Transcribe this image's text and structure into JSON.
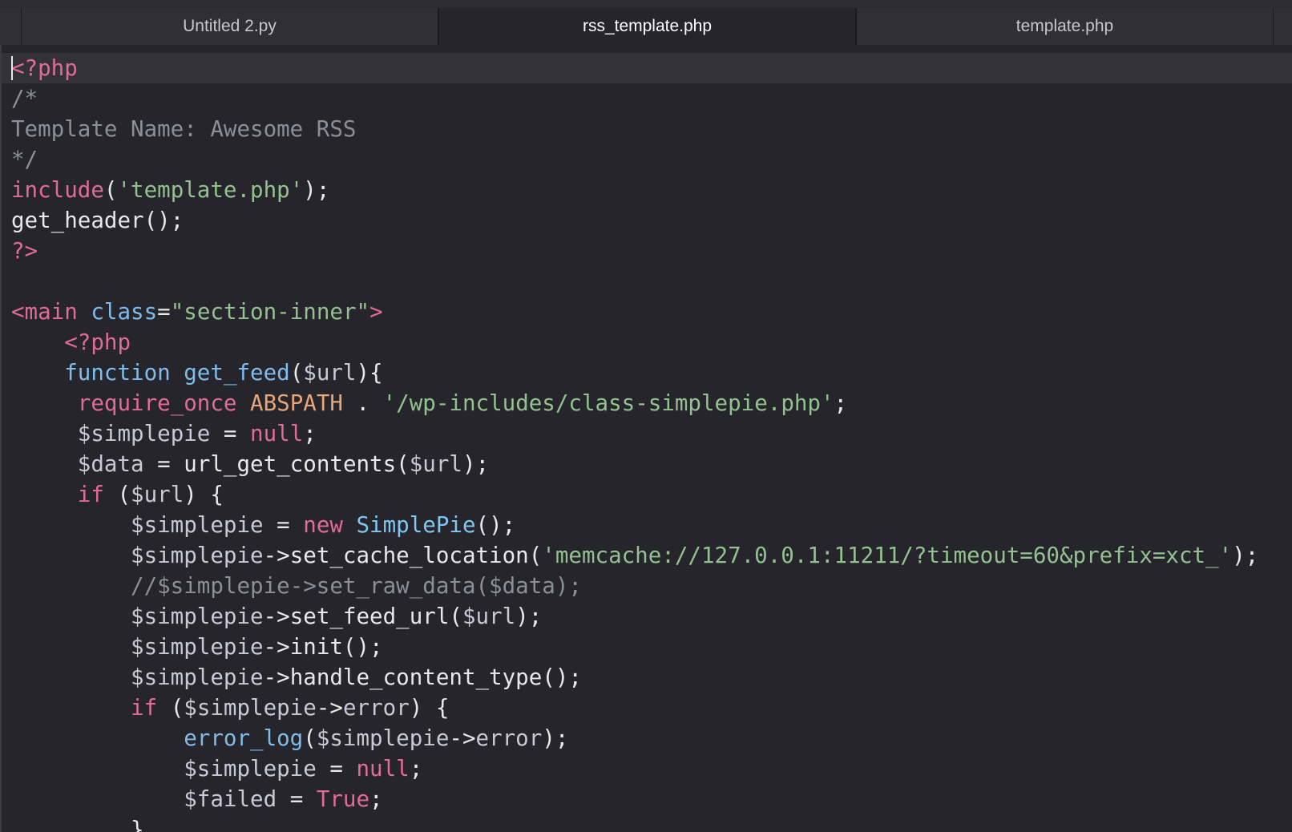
{
  "tabs": [
    {
      "label": "Untitled 2.py",
      "active": false
    },
    {
      "label": "rss_template.php",
      "active": true
    },
    {
      "label": "template.php",
      "active": false
    }
  ],
  "editor": {
    "lines": [
      [
        {
          "t": "<?php",
          "c": "kw"
        }
      ],
      [
        {
          "t": "/*",
          "c": "comment"
        }
      ],
      [
        {
          "t": "Template Name: Awesome RSS",
          "c": "comment"
        }
      ],
      [
        {
          "t": "*/",
          "c": "comment"
        }
      ],
      [
        {
          "t": "include",
          "c": "kw"
        },
        {
          "t": "(",
          "c": "plain"
        },
        {
          "t": "'template.php'",
          "c": "str"
        },
        {
          "t": ");",
          "c": "plain"
        }
      ],
      [
        {
          "t": "get_header();",
          "c": "plain"
        }
      ],
      [
        {
          "t": "?>",
          "c": "kw"
        }
      ],
      [],
      [
        {
          "t": "<main",
          "c": "tag"
        },
        {
          "t": " ",
          "c": "plain"
        },
        {
          "t": "class",
          "c": "attr"
        },
        {
          "t": "=",
          "c": "plain"
        },
        {
          "t": "\"section-inner\"",
          "c": "str"
        },
        {
          "t": ">",
          "c": "tag"
        }
      ],
      [
        {
          "t": "    ",
          "c": "plain"
        },
        {
          "t": "<?php",
          "c": "kw"
        }
      ],
      [
        {
          "t": "    ",
          "c": "plain"
        },
        {
          "t": "function",
          "c": "fn"
        },
        {
          "t": " ",
          "c": "plain"
        },
        {
          "t": "get_feed",
          "c": "fn"
        },
        {
          "t": "(",
          "c": "plain"
        },
        {
          "t": "$url",
          "c": "var"
        },
        {
          "t": "){",
          "c": "plain"
        }
      ],
      [
        {
          "t": "     ",
          "c": "plain"
        },
        {
          "t": "require_once",
          "c": "kw"
        },
        {
          "t": " ",
          "c": "plain"
        },
        {
          "t": "ABSPATH",
          "c": "const"
        },
        {
          "t": " . ",
          "c": "plain"
        },
        {
          "t": "'/wp-includes/class-simplepie.php'",
          "c": "str"
        },
        {
          "t": ";",
          "c": "plain"
        }
      ],
      [
        {
          "t": "     ",
          "c": "plain"
        },
        {
          "t": "$simplepie",
          "c": "var"
        },
        {
          "t": " = ",
          "c": "plain"
        },
        {
          "t": "null",
          "c": "kw"
        },
        {
          "t": ";",
          "c": "plain"
        }
      ],
      [
        {
          "t": "     ",
          "c": "plain"
        },
        {
          "t": "$data",
          "c": "var"
        },
        {
          "t": " = url_get_contents(",
          "c": "plain"
        },
        {
          "t": "$url",
          "c": "var"
        },
        {
          "t": ");",
          "c": "plain"
        }
      ],
      [
        {
          "t": "     ",
          "c": "plain"
        },
        {
          "t": "if",
          "c": "kw"
        },
        {
          "t": " (",
          "c": "plain"
        },
        {
          "t": "$url",
          "c": "var"
        },
        {
          "t": ") {",
          "c": "plain"
        }
      ],
      [
        {
          "t": "         ",
          "c": "plain"
        },
        {
          "t": "$simplepie",
          "c": "var"
        },
        {
          "t": " = ",
          "c": "plain"
        },
        {
          "t": "new",
          "c": "kw"
        },
        {
          "t": " ",
          "c": "plain"
        },
        {
          "t": "SimplePie",
          "c": "class"
        },
        {
          "t": "();",
          "c": "plain"
        }
      ],
      [
        {
          "t": "         ",
          "c": "plain"
        },
        {
          "t": "$simplepie",
          "c": "var"
        },
        {
          "t": "->set_cache_location(",
          "c": "plain"
        },
        {
          "t": "'memcache://127.0.0.1:11211/?timeout=60&prefix=xct_'",
          "c": "str"
        },
        {
          "t": ");",
          "c": "plain"
        }
      ],
      [
        {
          "t": "         ",
          "c": "plain"
        },
        {
          "t": "//$simplepie->set_raw_data($data);",
          "c": "comment"
        }
      ],
      [
        {
          "t": "         ",
          "c": "plain"
        },
        {
          "t": "$simplepie",
          "c": "var"
        },
        {
          "t": "->set_feed_url(",
          "c": "plain"
        },
        {
          "t": "$url",
          "c": "var"
        },
        {
          "t": ");",
          "c": "plain"
        }
      ],
      [
        {
          "t": "         ",
          "c": "plain"
        },
        {
          "t": "$simplepie",
          "c": "var"
        },
        {
          "t": "->init();",
          "c": "plain"
        }
      ],
      [
        {
          "t": "         ",
          "c": "plain"
        },
        {
          "t": "$simplepie",
          "c": "var"
        },
        {
          "t": "->handle_content_type();",
          "c": "plain"
        }
      ],
      [
        {
          "t": "         ",
          "c": "plain"
        },
        {
          "t": "if",
          "c": "kw"
        },
        {
          "t": " (",
          "c": "plain"
        },
        {
          "t": "$simplepie",
          "c": "var"
        },
        {
          "t": "->",
          "c": "plain"
        },
        {
          "t": "error",
          "c": "prop"
        },
        {
          "t": ") {",
          "c": "plain"
        }
      ],
      [
        {
          "t": "             ",
          "c": "plain"
        },
        {
          "t": "error_log",
          "c": "fn"
        },
        {
          "t": "(",
          "c": "plain"
        },
        {
          "t": "$simplepie",
          "c": "var"
        },
        {
          "t": "->",
          "c": "plain"
        },
        {
          "t": "error",
          "c": "prop"
        },
        {
          "t": ");",
          "c": "plain"
        }
      ],
      [
        {
          "t": "             ",
          "c": "plain"
        },
        {
          "t": "$simplepie",
          "c": "var"
        },
        {
          "t": " = ",
          "c": "plain"
        },
        {
          "t": "null",
          "c": "kw"
        },
        {
          "t": ";",
          "c": "plain"
        }
      ],
      [
        {
          "t": "             ",
          "c": "plain"
        },
        {
          "t": "$failed",
          "c": "var"
        },
        {
          "t": " = ",
          "c": "plain"
        },
        {
          "t": "True",
          "c": "kw"
        },
        {
          "t": ";",
          "c": "plain"
        }
      ],
      [
        {
          "t": "         ",
          "c": "plain"
        },
        {
          "t": "}",
          "c": "plain"
        }
      ]
    ]
  },
  "colors": {
    "keyword": "#e06c95",
    "string": "#93c18f",
    "comment": "#8b8f9a",
    "function": "#7fbcea",
    "constant": "#e8a57a",
    "background": "#25252b"
  }
}
